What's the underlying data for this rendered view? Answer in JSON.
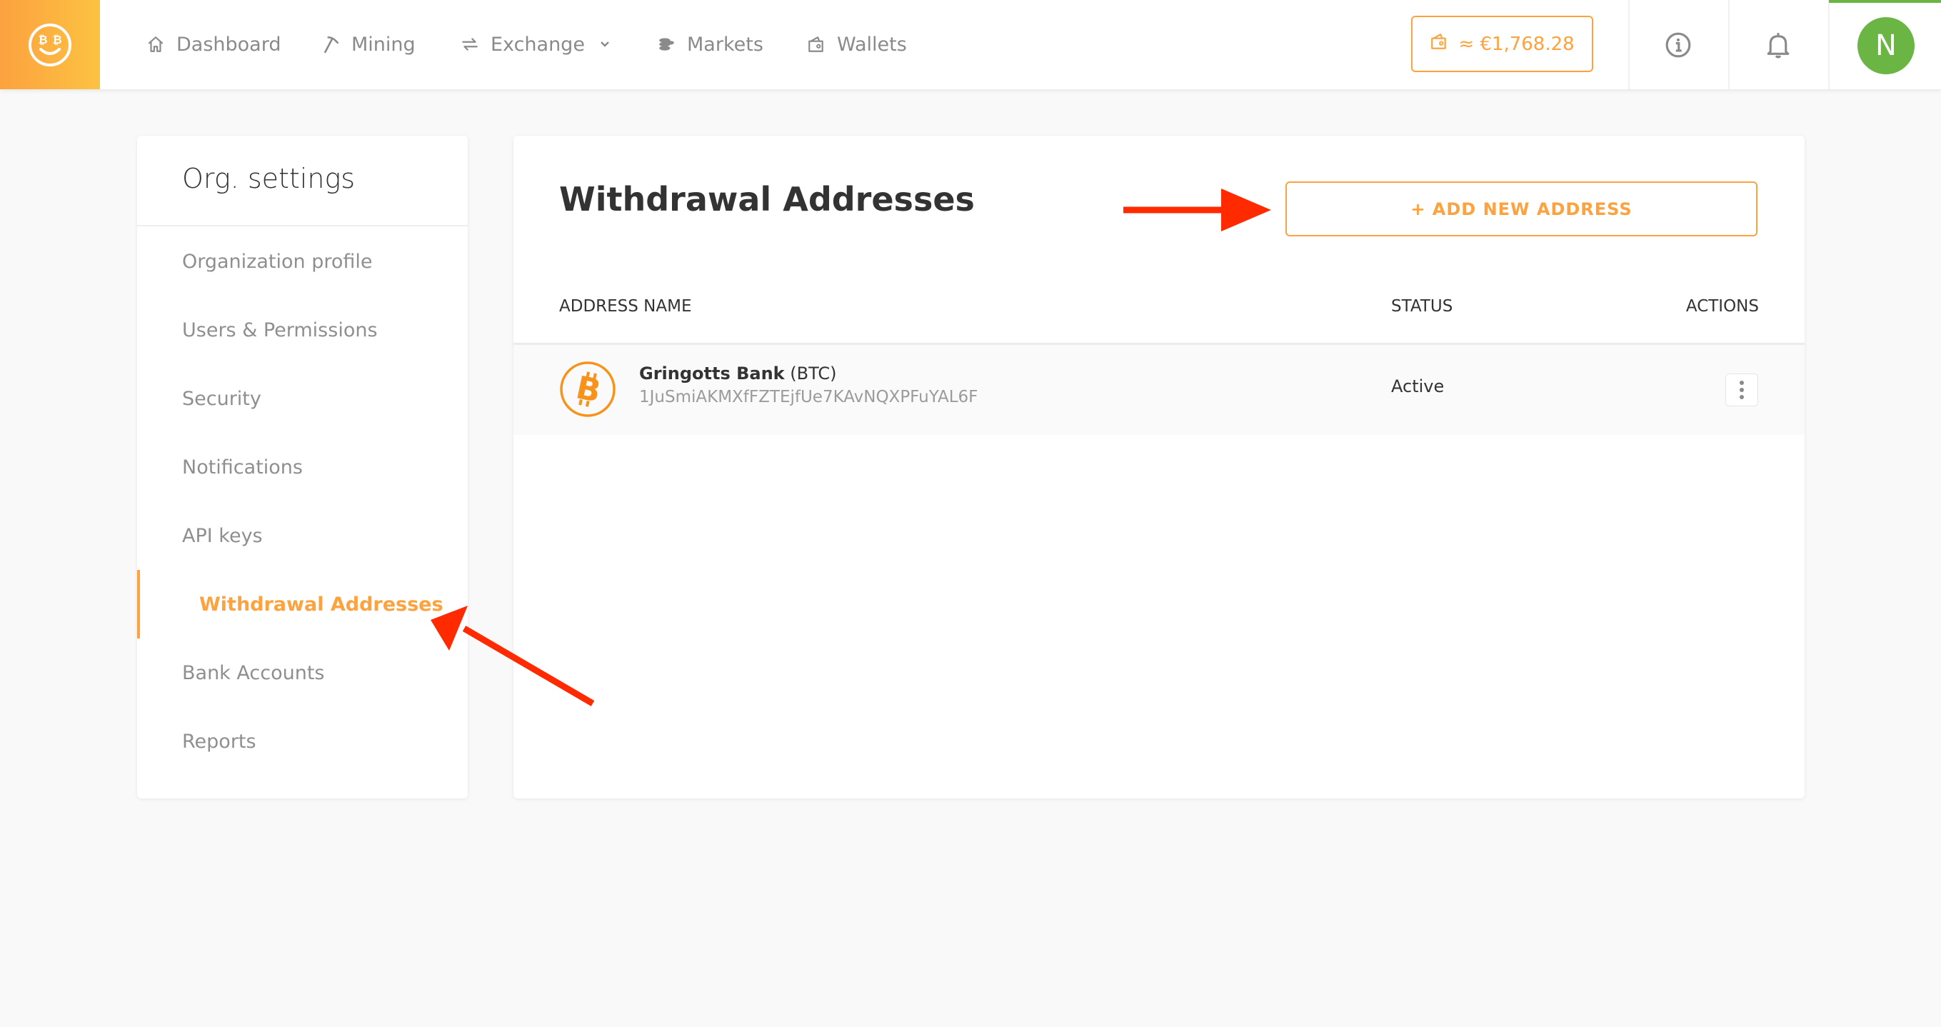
{
  "header": {
    "nav": [
      {
        "label": "Dashboard",
        "icon": "home-icon"
      },
      {
        "label": "Mining",
        "icon": "pickaxe-icon"
      },
      {
        "label": "Exchange",
        "icon": "exchange-arrows-icon",
        "has_dropdown": true
      },
      {
        "label": "Markets",
        "icon": "coins-stack-icon"
      },
      {
        "label": "Wallets",
        "icon": "wallet-icon"
      }
    ],
    "balance": "≈ €1,768.28",
    "avatar_initial": "N"
  },
  "colors": {
    "accent": "#fca23f",
    "avatar": "#6bb545",
    "annotation_arrow": "#ff2a00"
  },
  "sidebar": {
    "title": "Org. settings",
    "items": [
      {
        "label": "Organization profile",
        "active": false
      },
      {
        "label": "Users & Permissions",
        "active": false
      },
      {
        "label": "Security",
        "active": false
      },
      {
        "label": "Notifications",
        "active": false
      },
      {
        "label": "API keys",
        "active": false
      },
      {
        "label": "Withdrawal Addresses",
        "active": true
      },
      {
        "label": "Bank Accounts",
        "active": false
      },
      {
        "label": "Reports",
        "active": false
      }
    ]
  },
  "main": {
    "title": "Withdrawal Addresses",
    "add_button": "+ ADD NEW ADDRESS",
    "columns": [
      "ADDRESS NAME",
      "STATUS",
      "ACTIONS"
    ],
    "rows": [
      {
        "name": "Gringotts Bank",
        "currency": "(BTC)",
        "address": "1JuSmiAKMXfFZTEjfUe7KAvNQXPFuYAL6F",
        "status": "Active",
        "icon": "bitcoin-icon"
      }
    ]
  }
}
